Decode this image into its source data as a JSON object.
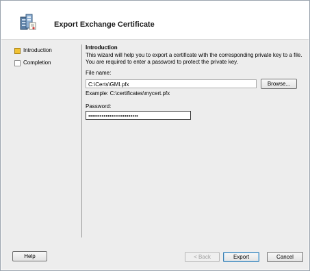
{
  "header": {
    "title": "Export Exchange Certificate",
    "icon": "certificate-server-icon"
  },
  "steps": [
    {
      "label": "Introduction",
      "active": true
    },
    {
      "label": "Completion",
      "active": false
    }
  ],
  "content": {
    "section_title": "Introduction",
    "description": "This wizard will help you to export a certificate with the corresponding private key to a file. You are required to enter a password to protect the private key.",
    "file_name_label": "File name:",
    "file_name_value": "C:\\Certs\\GMI.pfx",
    "browse_label": "Browse...",
    "example_text": "Example: C:\\certificates\\mycert.pfx",
    "password_label": "Password:",
    "password_value": "••••••••••••••••••••••••••"
  },
  "footer": {
    "help_label": "Help",
    "back_label": "< Back",
    "export_label": "Export",
    "cancel_label": "Cancel"
  },
  "colors": {
    "active_step": "#f1c233",
    "body_background": "#ededed"
  }
}
